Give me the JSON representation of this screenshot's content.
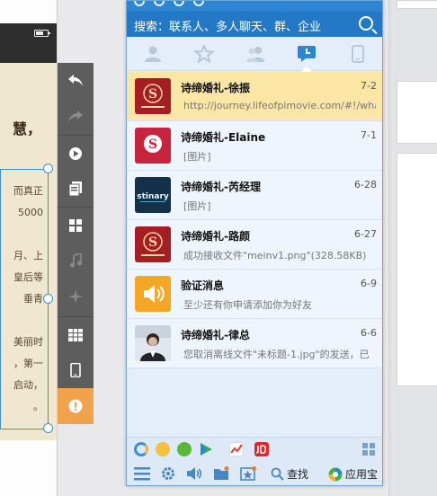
{
  "phone": {
    "title_text": "慧，",
    "lines": [
      "而真正",
      "5000",
      "月、上",
      "皇后等",
      "垂青",
      "美丽时",
      "，第一",
      "启动，",
      "。"
    ]
  },
  "qq": {
    "search": {
      "placeholder": "搜索：联系人、多人聊天、群、企业"
    },
    "tabs": [
      {
        "name": "contacts",
        "icon": "person-icon"
      },
      {
        "name": "favorites",
        "icon": "star-icon"
      },
      {
        "name": "groups",
        "icon": "group-icon"
      },
      {
        "name": "recent",
        "icon": "chat-clock-icon"
      },
      {
        "name": "devices",
        "icon": "phone-icon"
      }
    ],
    "sessions": [
      {
        "name": "诗缔婚礼-徐振",
        "date": "7-2",
        "preview": "http://journey.lifeofpimovie.com/#!/whale",
        "avatar": "shidi-logo"
      },
      {
        "name": "诗缔婚礼-Elaine",
        "date": "7-1",
        "preview": "[图片]",
        "avatar": "shidi-s-logo"
      },
      {
        "name": "诗缔婚礼-芮经理",
        "date": "6-28",
        "preview": "[图片]",
        "avatar": "stinary-logo"
      },
      {
        "name": "诗缔婚礼-路颜",
        "date": "6-27",
        "preview": "成功接收文件\"meinv1.png\"(328.58KB)",
        "avatar": "shidi-logo"
      },
      {
        "name": "验证消息",
        "date": "6-9",
        "preview": "至少还有你申请添加你为好友",
        "avatar": "speaker-icon"
      },
      {
        "name": "诗缔婚礼-律总",
        "date": "6-6",
        "preview": "您取消离线文件\"未标题-1.jpg\"的发送，已",
        "avatar": "person-photo"
      }
    ],
    "bottom": {
      "find_label": "查找",
      "appstore_label": "应用宝"
    }
  },
  "colors": {
    "header_blue": "#2c86d4",
    "selected_row": "#fce6a6",
    "tool_alert": "#f3a24c"
  }
}
